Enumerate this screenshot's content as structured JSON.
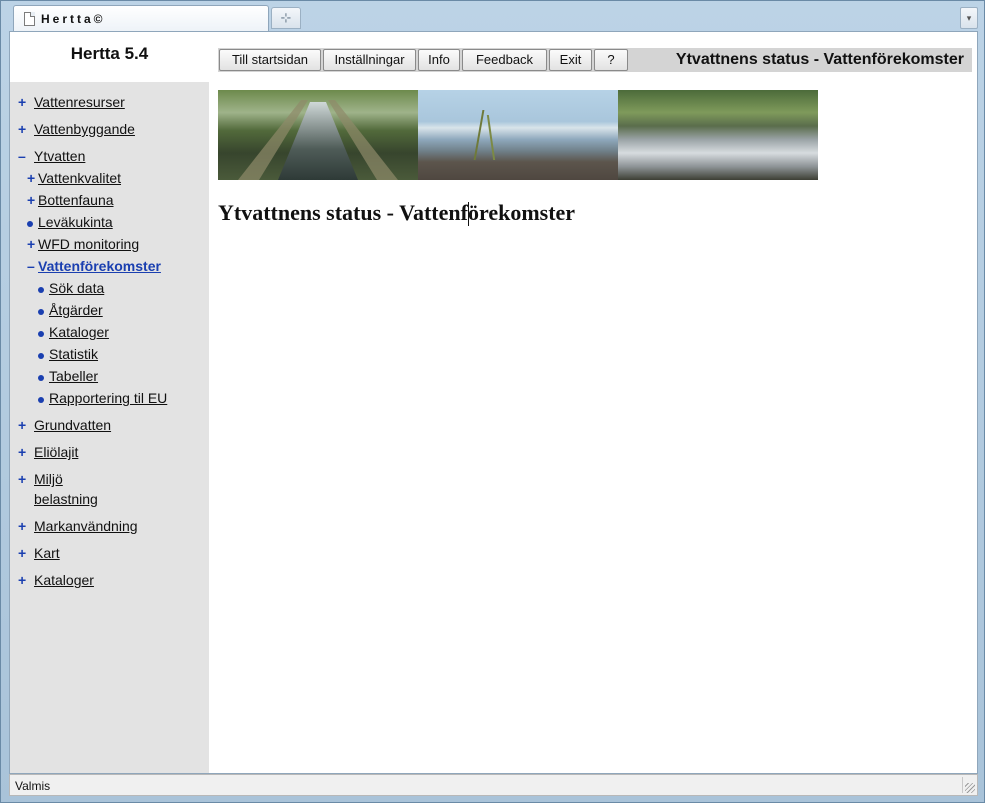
{
  "browser": {
    "tab_title": "Hertta©",
    "new_tab_glyph": "⊹",
    "tab_list_glyph": "▾"
  },
  "sidebar": {
    "app_title": "Hertta 5.4",
    "items": [
      {
        "marker": "+",
        "label": "Vattenresurser"
      },
      {
        "marker": "+",
        "label": "Vattenbyggande"
      },
      {
        "marker": "–",
        "label": "Ytvatten"
      },
      {
        "marker": "+",
        "label": "Vattenkvalitet"
      },
      {
        "marker": "+",
        "label": "Bottenfauna"
      },
      {
        "marker": "•",
        "label": "Leväkukinta"
      },
      {
        "marker": "+",
        "label": "WFD monitoring"
      },
      {
        "marker": "–",
        "label": "Vattenförekomster",
        "active": true
      },
      {
        "marker": "•",
        "label": "Sök data"
      },
      {
        "marker": "•",
        "label": "Åtgärder"
      },
      {
        "marker": "•",
        "label": "Kataloger"
      },
      {
        "marker": "•",
        "label": "Statistik"
      },
      {
        "marker": "•",
        "label": "Tabeller"
      },
      {
        "marker": "•",
        "label": "Rapportering til EU"
      },
      {
        "marker": "+",
        "label": "Grundvatten"
      },
      {
        "marker": "+",
        "label": "Eliölajit"
      },
      {
        "marker": "+",
        "label": "Miljö",
        "label2": "belastning"
      },
      {
        "marker": "+",
        "label": "Markanvändning"
      },
      {
        "marker": "+",
        "label": "Kart"
      },
      {
        "marker": "+",
        "label": "Kataloger"
      }
    ]
  },
  "toolbar": {
    "buttons": [
      "Till startsidan",
      "Inställningar",
      "Info",
      "Feedback",
      "Exit",
      "?"
    ],
    "page_title": "Ytvattnens status - Vattenförekomster"
  },
  "main": {
    "heading": "Ytvattnens status - Vattenförekomster"
  },
  "statusbar": {
    "text": "Valmis"
  },
  "colors": {
    "link_accent": "#1a3fb0",
    "sidebar_bg": "#e3e3e3",
    "toolbar_bg": "#d4d4d4"
  }
}
